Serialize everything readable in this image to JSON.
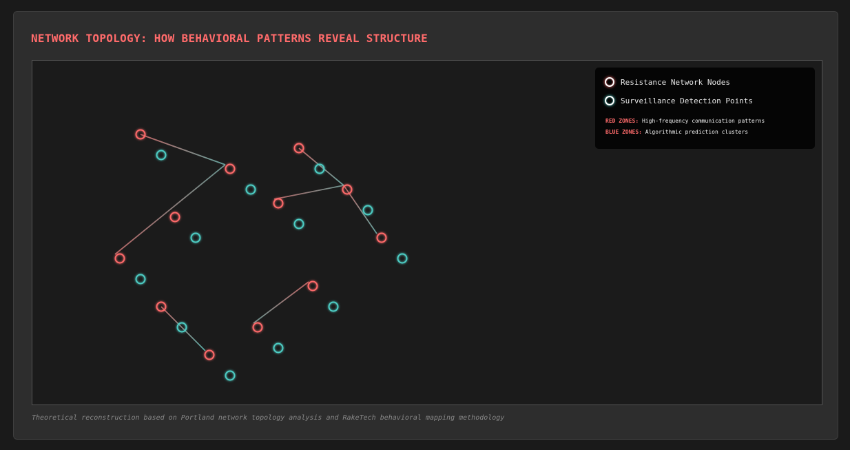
{
  "title": "Network Topology: How Behavioral Patterns Reveal Structure",
  "legend": {
    "items": [
      {
        "label": "Resistance Network Nodes",
        "icon": "red-ring-icon",
        "color": "#ff6b6b"
      },
      {
        "label": "Surveillance Detection Points",
        "icon": "teal-ring-icon",
        "color": "#4ecdc4"
      }
    ],
    "zones": [
      {
        "key": "RED ZONES:",
        "text": " High-frequency communication patterns"
      },
      {
        "key": "BLUE ZONES:",
        "text": " Algorithmic prediction clusters"
      }
    ]
  },
  "caption": "Theoretical reconstruction based on Portland network topology analysis and RakeTech behavioral mapping methodology",
  "colors": {
    "resistance": "#ff6b6b",
    "surveillance": "#4ecdc4",
    "background": "#1b1b1b"
  }
}
